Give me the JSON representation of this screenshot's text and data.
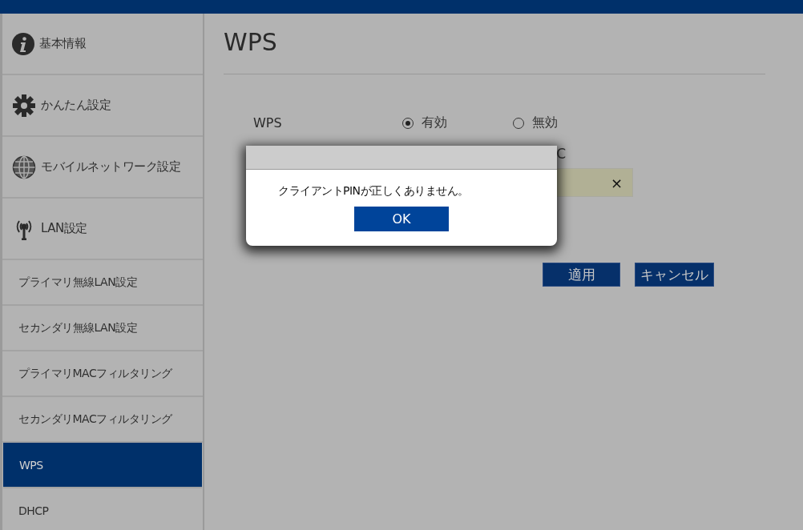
{
  "sidebar": {
    "items": [
      {
        "label": "基本情報",
        "kind": "info",
        "selected": false
      },
      {
        "label": "かんたん設定",
        "kind": "gear",
        "selected": false
      },
      {
        "label": "モバイルネットワーク設定",
        "kind": "globe",
        "selected": false
      },
      {
        "label": "LAN設定",
        "kind": "antenna",
        "selected": false
      },
      {
        "label": "プライマリ無線LAN設定",
        "kind": "sub",
        "selected": false
      },
      {
        "label": "セカンダリ無線LAN設定",
        "kind": "sub",
        "selected": false
      },
      {
        "label": "プライマリMACフィルタリング",
        "kind": "sub",
        "selected": false
      },
      {
        "label": "セカンダリMACフィルタリング",
        "kind": "sub",
        "selected": false
      },
      {
        "label": "WPS",
        "kind": "sub",
        "selected": true
      },
      {
        "label": "DHCP",
        "kind": "sub",
        "selected": false
      }
    ]
  },
  "page": {
    "title": "WPS",
    "wps": {
      "label": "WPS",
      "options": [
        {
          "label": "有効",
          "selected": true
        },
        {
          "label": "無効",
          "selected": false
        }
      ]
    },
    "partial_label": "C",
    "clear_button": "×",
    "buttons": [
      "適用",
      "キャンセル"
    ]
  },
  "dialog": {
    "message": "クライアントPINが正しくありません。",
    "ok": "OK"
  }
}
